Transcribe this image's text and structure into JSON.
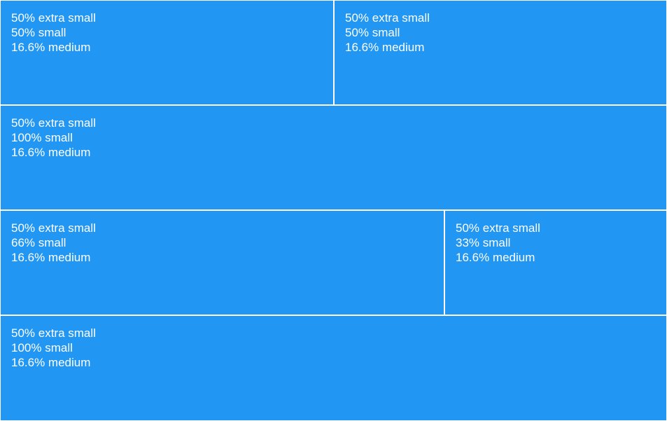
{
  "rows": [
    {
      "cells": [
        {
          "xs": "50% extra small",
          "sm": "50% small",
          "md": "16.6% medium"
        },
        {
          "xs": "50% extra small",
          "sm": "50% small",
          "md": "16.6% medium"
        }
      ]
    },
    {
      "cells": [
        {
          "xs": "50% extra small",
          "sm": "100% small",
          "md": "16.6% medium"
        }
      ]
    },
    {
      "cells": [
        {
          "xs": "50% extra small",
          "sm": "66% small",
          "md": "16.6% medium"
        },
        {
          "xs": "50% extra small",
          "sm": "33% small",
          "md": "16.6% medium"
        }
      ]
    },
    {
      "cells": [
        {
          "xs": "50% extra small",
          "sm": "100% small",
          "md": "16.6% medium"
        }
      ]
    }
  ],
  "colors": {
    "cell_background": "#2196F3",
    "cell_text": "#FFFFFF",
    "gutter": "#FFFFFF"
  }
}
